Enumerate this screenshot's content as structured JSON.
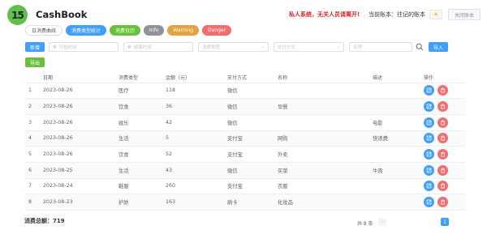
{
  "header": {
    "logo_text": "15",
    "app_title": "CashBook",
    "warning_text": "私人系统，无关人员请离开!",
    "book_label": "当前账本：往记的账本",
    "sun_icon": "☀",
    "close_label": "关闭账本"
  },
  "tabs": [
    {
      "label": "日消费曲线",
      "style": "default"
    },
    {
      "label": "消费类型统计",
      "style": "primary"
    },
    {
      "label": "消费日历",
      "style": "success"
    },
    {
      "label": "Info",
      "style": "info"
    },
    {
      "label": "Warning",
      "style": "warning"
    },
    {
      "label": "Danger",
      "style": "danger"
    }
  ],
  "toolbar": {
    "add_label": "新增",
    "import_label": "导入",
    "export_label": "导出",
    "start_placeholder": "开始时间",
    "end_placeholder": "结束时间",
    "type_placeholder": "消费类型",
    "pay_placeholder": "支付方式",
    "name_placeholder": "名称"
  },
  "table": {
    "columns": [
      "",
      "日期",
      "消费类型",
      "金额（元）",
      "支付方式",
      "名称",
      "描述",
      "操作"
    ],
    "rows": [
      [
        "1",
        "2023-08-26",
        "医疗",
        "118",
        "微信",
        "",
        "",
        ""
      ],
      [
        "2",
        "2023-08-26",
        "饮食",
        "36",
        "微信",
        "早餐",
        "",
        ""
      ],
      [
        "3",
        "2023-08-26",
        "娱乐",
        "42",
        "微信",
        "",
        "电影",
        ""
      ],
      [
        "4",
        "2023-08-26",
        "生活",
        "5",
        "支付宝",
        "网购",
        "快递费",
        ""
      ],
      [
        "5",
        "2023-08-26",
        "饮食",
        "52",
        "支付宝",
        "外卖",
        "",
        ""
      ],
      [
        "6",
        "2023-08-25",
        "生活",
        "43",
        "微信",
        "买菜",
        "牛肉",
        ""
      ],
      [
        "7",
        "2023-08-24",
        "鞋服",
        "260",
        "支付宝",
        "衣服",
        "",
        ""
      ],
      [
        "8",
        "2023-08-23",
        "护肤",
        "163",
        "刷卡",
        "化妆品",
        "",
        ""
      ]
    ]
  },
  "footer": {
    "total_label": "消费总额：",
    "total_value": "719",
    "count_text": "共 8 条",
    "prev": "‹",
    "page": "1"
  },
  "colors": {
    "primary": "#409eff",
    "success": "#67c23a",
    "danger": "#f56c6c",
    "warning": "#e6a23c",
    "info": "#909399",
    "warning_text": "#e01f1f"
  }
}
